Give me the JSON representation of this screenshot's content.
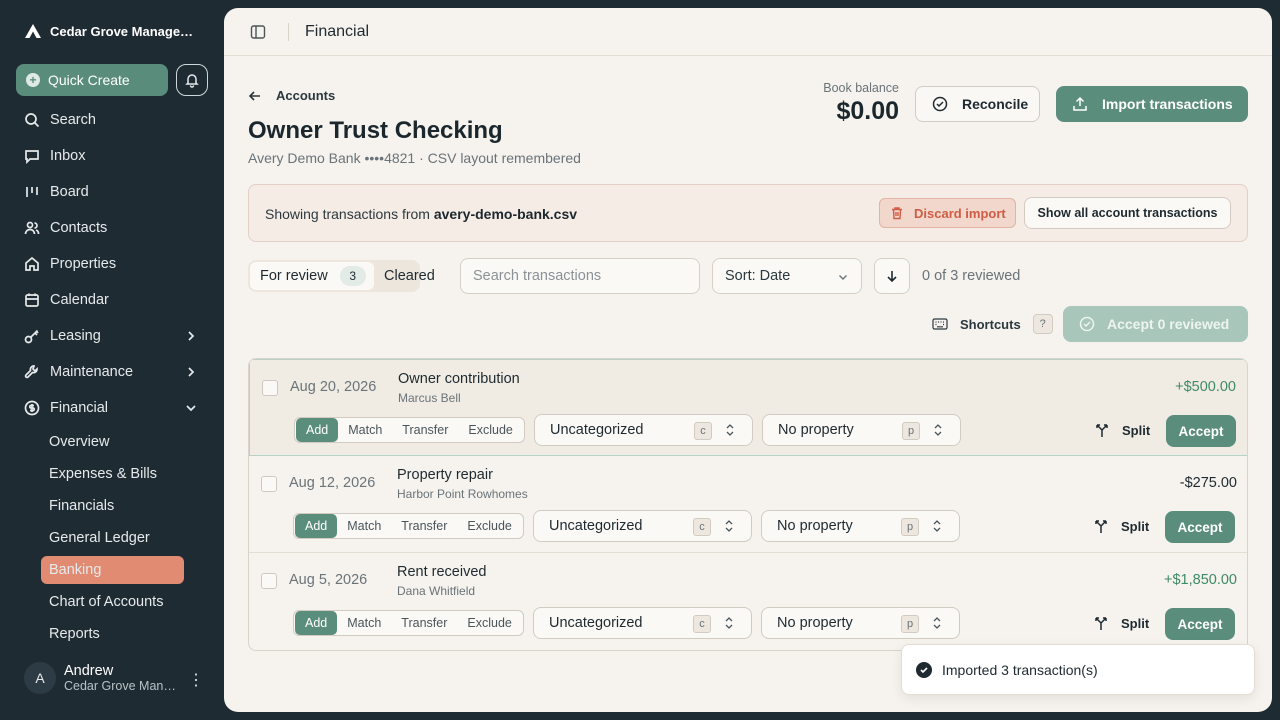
{
  "sidebar": {
    "org_name": "Cedar Grove Manageme...",
    "quick_create": "Quick Create",
    "items": [
      {
        "label": "Search"
      },
      {
        "label": "Inbox"
      },
      {
        "label": "Board"
      },
      {
        "label": "Contacts"
      },
      {
        "label": "Properties"
      },
      {
        "label": "Calendar"
      },
      {
        "label": "Leasing"
      },
      {
        "label": "Maintenance"
      },
      {
        "label": "Financial"
      }
    ],
    "financial_sub": [
      {
        "label": "Overview"
      },
      {
        "label": "Expenses & Bills"
      },
      {
        "label": "Financials"
      },
      {
        "label": "General Ledger"
      },
      {
        "label": "Banking"
      },
      {
        "label": "Chart of Accounts"
      },
      {
        "label": "Reports"
      }
    ],
    "user": {
      "initial": "A",
      "name": "Andrew",
      "org": "Cedar Grove Mana..."
    }
  },
  "header": {
    "title": "Financial"
  },
  "account": {
    "back_label": "Accounts",
    "name": "Owner Trust Checking",
    "subtitle": "Avery Demo Bank ••••4821 · CSV layout remembered",
    "book_balance_label": "Book balance",
    "book_balance": "$0.00",
    "reconcile_label": "Reconcile",
    "import_label": "Import transactions"
  },
  "banner": {
    "prefix": "Showing transactions from",
    "filename": "avery-demo-bank.csv",
    "discard_label": "Discard import",
    "show_all_label": "Show all account transactions"
  },
  "filters": {
    "tab_review": "For review",
    "tab_review_count": "3",
    "tab_cleared": "Cleared",
    "search_placeholder": "Search transactions",
    "sort_label": "Sort: Date",
    "reviewed_text": "0 of 3 reviewed",
    "shortcuts_label": "Shortcuts",
    "shortcuts_key": "?",
    "accept_all_label": "Accept 0 reviewed"
  },
  "row_controls": {
    "modes": [
      "Add",
      "Match",
      "Transfer",
      "Exclude"
    ],
    "category": "Uncategorized",
    "category_key": "c",
    "property": "No property",
    "property_key": "p",
    "split_label": "Split",
    "accept_label": "Accept"
  },
  "transactions": [
    {
      "date": "Aug 20, 2026",
      "description": "Owner contribution",
      "payee": "Marcus Bell",
      "amount": "+$500.00"
    },
    {
      "date": "Aug 12, 2026",
      "description": "Property repair",
      "payee": "Harbor Point Rowhomes",
      "amount": "-$275.00"
    },
    {
      "date": "Aug 5, 2026",
      "description": "Rent received",
      "payee": "Dana Whitfield",
      "amount": "+$1,850.00"
    }
  ],
  "toast": {
    "message": "Imported 3 transaction(s)"
  },
  "colors": {
    "accent": "#5b8d7d",
    "sidebar_bg": "#1f2b33",
    "active_nav": "#e08b72",
    "positive": "#3e8a66",
    "danger": "#cf5d45"
  }
}
